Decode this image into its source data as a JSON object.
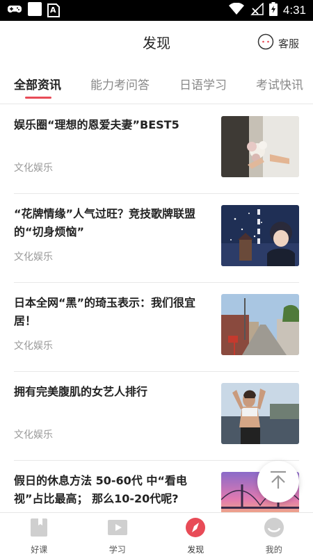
{
  "status_bar": {
    "time": "4:31",
    "sim_label": "A"
  },
  "header": {
    "title": "发现",
    "service_label": "客服"
  },
  "tabs": [
    {
      "label": "全部资讯",
      "active": true
    },
    {
      "label": "能力考问答",
      "active": false
    },
    {
      "label": "日语学习",
      "active": false
    },
    {
      "label": "考试快讯",
      "active": false
    }
  ],
  "articles": [
    {
      "title": "娱乐圈“理想的恩爱夫妻”BEST5",
      "category": "文化娱乐",
      "thumb": "bride-bouquet"
    },
    {
      "title": "“花牌情缘”人气过旺？竞技歌牌联盟的“切身烦恼”",
      "category": "文化娱乐",
      "thumb": "anime-night-scene"
    },
    {
      "title": "日本全网“黑”的琦玉表示：我们很宜居！",
      "category": "文化娱乐",
      "thumb": "japanese-street"
    },
    {
      "title": "拥有完美腹肌的女艺人排行",
      "category": "文化娱乐",
      "thumb": "fitness-woman"
    },
    {
      "title": "假日的休息方法 50-60代 中“看电视”占比最高； 那么10-20代呢?",
      "category": "",
      "thumb": "sunset-bridge"
    }
  ],
  "bottom_nav": [
    {
      "label": "好课",
      "icon": "book-icon",
      "active": false
    },
    {
      "label": "学习",
      "icon": "play-icon",
      "active": false
    },
    {
      "label": "发现",
      "icon": "compass-icon",
      "active": true
    },
    {
      "label": "我的",
      "icon": "profile-icon",
      "active": false
    }
  ],
  "colors": {
    "accent": "#e84b57",
    "nav_inactive": "#cfcfcf"
  }
}
